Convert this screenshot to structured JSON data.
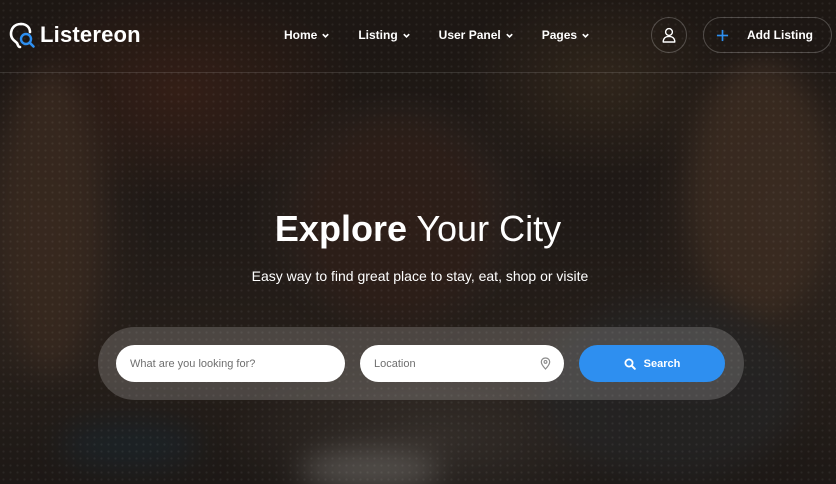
{
  "brand": {
    "name": "Listereon",
    "accent": "#2e8ff0"
  },
  "nav": {
    "items": [
      {
        "label": "Home",
        "icon": "chevron-down-icon"
      },
      {
        "label": "Listing",
        "icon": "chevron-down-icon"
      },
      {
        "label": "User Panel",
        "icon": "chevron-down-icon"
      },
      {
        "label": "Pages",
        "icon": "chevron-down-icon"
      }
    ],
    "user_icon": "user-icon",
    "add_listing_label": "Add Listing"
  },
  "hero": {
    "title_strong": "Explore",
    "title_rest": "Your City",
    "subtitle": "Easy way to find great place to stay, eat, shop or visite"
  },
  "search": {
    "what_placeholder": "What are you looking for?",
    "location_placeholder": "Location",
    "button_label": "Search"
  }
}
